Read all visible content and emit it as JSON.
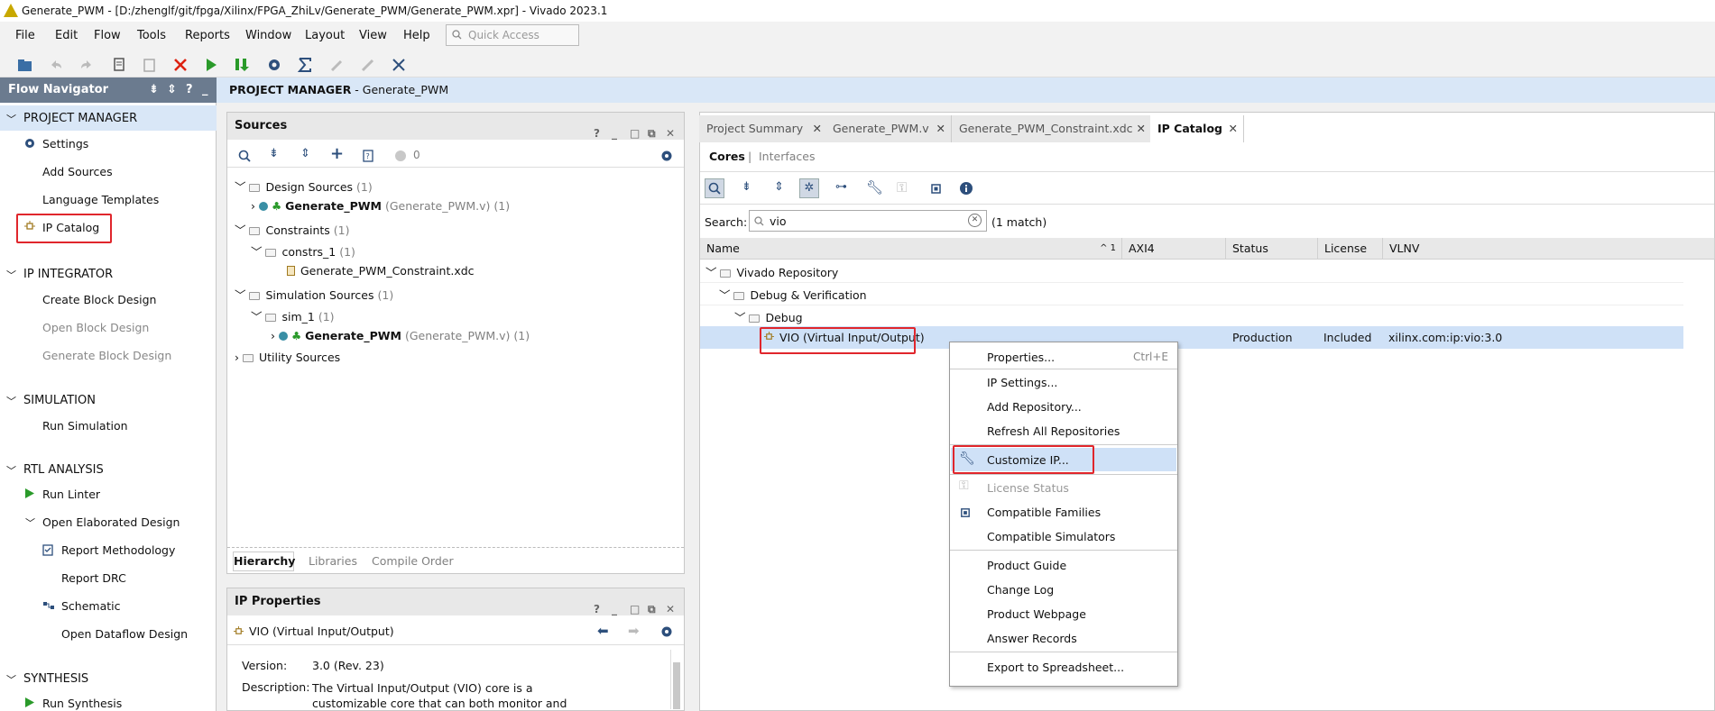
{
  "window": {
    "title": "Generate_PWM - [D:/zhenglf/git/fpga/Xilinx/FPGA_ZhiLv/Generate_PWM/Generate_PWM.xpr] - Vivado 2023.1"
  },
  "menubar": {
    "items": [
      "File",
      "Edit",
      "Flow",
      "Tools",
      "Reports",
      "Window",
      "Layout",
      "View",
      "Help"
    ],
    "quick_access_placeholder": "Quick Access"
  },
  "flow_navigator": {
    "title": "Flow Navigator",
    "sections": [
      {
        "label": "PROJECT MANAGER",
        "items": [
          "Settings",
          "Add Sources",
          "Language Templates",
          "IP Catalog"
        ]
      },
      {
        "label": "IP INTEGRATOR",
        "items": [
          "Create Block Design",
          "Open Block Design",
          "Generate Block Design"
        ]
      },
      {
        "label": "SIMULATION",
        "items": [
          "Run Simulation"
        ]
      },
      {
        "label": "RTL ANALYSIS",
        "items": [
          "Run Linter",
          "Open Elaborated Design",
          "Report Methodology",
          "Report DRC",
          "Schematic",
          "Open Dataflow Design"
        ]
      },
      {
        "label": "SYNTHESIS",
        "items": [
          "Run Synthesis"
        ]
      }
    ]
  },
  "project_manager_header": {
    "prefix": "PROJECT MANAGER",
    "suffix": " - Generate_PWM"
  },
  "sources": {
    "title": "Sources",
    "badge_count": "0",
    "tree": {
      "design_sources": "Design Sources",
      "design_sources_count": "(1)",
      "generate_pwm": "Generate_PWM",
      "generate_pwm_file": "(Generate_PWM.v) (1)",
      "constraints": "Constraints",
      "constraints_count": "(1)",
      "constrs_1": "constrs_1",
      "constrs_1_count": "(1)",
      "constraint_file": "Generate_PWM_Constraint.xdc",
      "simulation_sources": "Simulation Sources",
      "simulation_sources_count": "(1)",
      "sim_1": "sim_1",
      "sim_1_count": "(1)",
      "sim_generate_pwm": "Generate_PWM",
      "sim_generate_pwm_file": "(Generate_PWM.v) (1)",
      "utility_sources": "Utility Sources"
    },
    "tabs": [
      "Hierarchy",
      "Libraries",
      "Compile Order"
    ]
  },
  "ip_properties": {
    "title": "IP Properties",
    "selected": "VIO (Virtual Input/Output)",
    "version_label": "Version:",
    "version_value": "3.0 (Rev. 23)",
    "description_label": "Description:",
    "description_line1": "The Virtual Input/Output (VIO) core is a",
    "description_line2": "customizable core that can both monitor and"
  },
  "editor_tabs": [
    "Project Summary",
    "Generate_PWM.v",
    "Generate_PWM_Constraint.xdc",
    "IP Catalog"
  ],
  "ip_catalog": {
    "subtabs": [
      "Cores",
      "Interfaces"
    ],
    "search_label": "Search:",
    "search_value": "vio",
    "match_text": "(1 match)",
    "columns": [
      "Name",
      "AXI4",
      "Status",
      "License",
      "VLNV"
    ],
    "sort_indicator": "1",
    "tree": {
      "repo": "Vivado Repository",
      "category": "Debug & Verification",
      "subcategory": "Debug",
      "ip_name": "VIO (Virtual Input/Output)",
      "ip_status": "Production",
      "ip_license": "Included",
      "ip_vlnv": "xilinx.com:ip:vio:3.0"
    }
  },
  "context_menu": {
    "items": [
      {
        "label": "Properties...",
        "shortcut": "Ctrl+E"
      },
      {
        "label": "IP Settings..."
      },
      {
        "label": "Add Repository..."
      },
      {
        "label": "Refresh All Repositories"
      },
      {
        "label": "Customize IP..."
      },
      {
        "label": "License Status"
      },
      {
        "label": "Compatible Families"
      },
      {
        "label": "Compatible Simulators"
      },
      {
        "label": "Product Guide"
      },
      {
        "label": "Change Log"
      },
      {
        "label": "Product Webpage"
      },
      {
        "label": "Answer Records"
      },
      {
        "label": "Export to Spreadsheet..."
      }
    ]
  },
  "colors": {
    "highlight_red": "#e0262c",
    "selection_blue": "#cfe1f7",
    "flow_nav_header": "#6b7b8f"
  }
}
